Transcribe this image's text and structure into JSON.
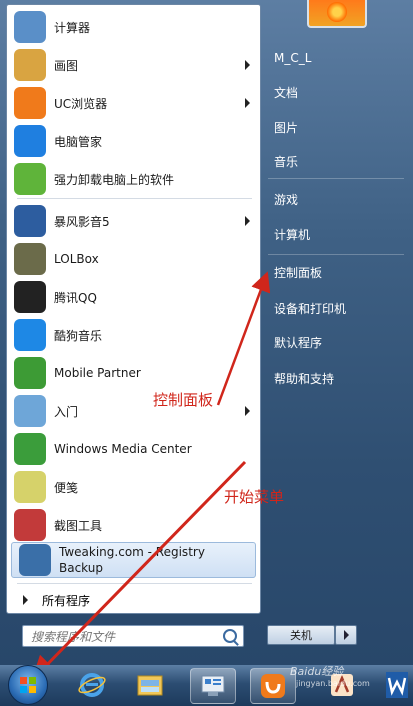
{
  "start_menu": {
    "programs": [
      {
        "label": "计算器",
        "icon": "calculator-icon",
        "color": "#5a8fc8",
        "arrow": false
      },
      {
        "label": "画图",
        "icon": "paint-palette-icon",
        "color": "#d9a441",
        "arrow": true
      },
      {
        "label": "UC浏览器",
        "icon": "uc-browser-icon",
        "color": "#f07a1b",
        "arrow": true
      },
      {
        "label": "电脑管家",
        "icon": "pc-manager-shield-icon",
        "color": "#1f7fe0",
        "arrow": false
      },
      {
        "label": "强力卸载电脑上的软件",
        "icon": "uninstall-icon",
        "color": "#5fb43a",
        "arrow": false
      },
      {
        "label": "暴风影音5",
        "icon": "storm-player-icon",
        "color": "#2d5d9f",
        "arrow": true
      },
      {
        "label": "LOLBox",
        "icon": "lolbox-icon",
        "color": "#6b6b4a",
        "arrow": false
      },
      {
        "label": "腾讯QQ",
        "icon": "qq-penguin-icon",
        "color": "#222222",
        "arrow": false
      },
      {
        "label": "酷狗音乐",
        "icon": "kugou-music-icon",
        "color": "#1e88e5",
        "arrow": false
      },
      {
        "label": "Mobile Partner",
        "icon": "mobile-partner-icon",
        "color": "#3d9b35",
        "arrow": false
      },
      {
        "label": "入门",
        "icon": "getting-started-icon",
        "color": "#6ea6d8",
        "arrow": true
      },
      {
        "label": "Windows Media Center",
        "icon": "windows-media-center-icon",
        "color": "#3b9d3b",
        "arrow": false
      },
      {
        "label": "便笺",
        "icon": "sticky-notes-icon",
        "color": "#d6d26a",
        "arrow": false
      },
      {
        "label": "截图工具",
        "icon": "snipping-tool-icon",
        "color": "#c23a3a",
        "arrow": false
      },
      {
        "label": "Tweaking.com - Registry Backup",
        "icon": "registry-backup-icon",
        "color": "#3a6fa8",
        "arrow": false
      }
    ],
    "all_programs_label": "所有程序",
    "search_placeholder": "搜索程序和文件",
    "right_items": [
      "M_C_L",
      "文档",
      "图片",
      "音乐",
      "游戏",
      "计算机",
      "控制面板",
      "设备和打印机",
      "默认程序",
      "帮助和支持"
    ],
    "shutdown_label": "关机"
  },
  "annotations": {
    "control_panel": "控制面板",
    "start_menu": "开始菜单",
    "color": "#d0261b"
  },
  "watermark": {
    "line1": "Baidu经验",
    "line2": "jingyan.baidu.com"
  }
}
